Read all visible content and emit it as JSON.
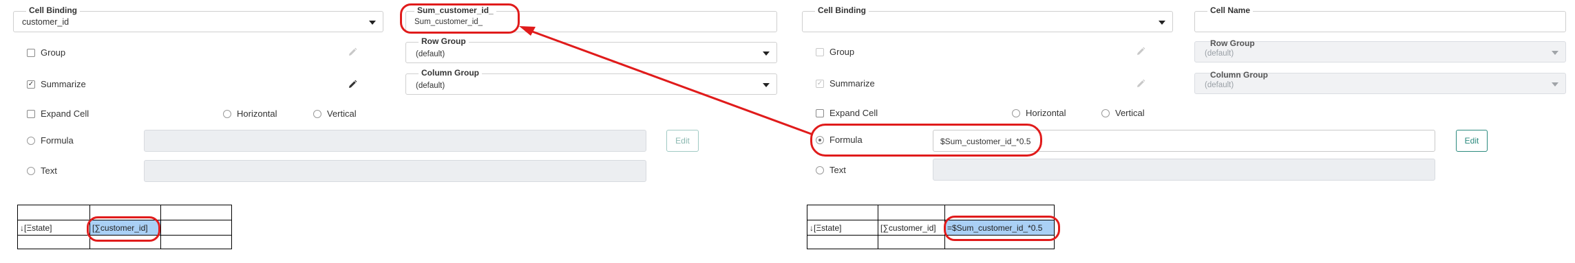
{
  "left_panel": {
    "cell_binding": {
      "legend": "Cell Binding",
      "value": "customer_id"
    },
    "cell_name": {
      "legend": "Sum_customer_id_",
      "value": "Sum_customer_id_"
    },
    "group": {
      "label": "Group",
      "checked": false
    },
    "row_group": {
      "legend": "Row Group",
      "value": "(default)"
    },
    "summarize": {
      "label": "Summarize",
      "checked": true
    },
    "column_group": {
      "legend": "Column Group",
      "value": "(default)"
    },
    "expand_cell": {
      "label": "Expand Cell",
      "checked": false
    },
    "horizontal": {
      "label": "Horizontal"
    },
    "vertical": {
      "label": "Vertical"
    },
    "formula": {
      "label": "Formula",
      "value": ""
    },
    "edit_button": "Edit",
    "text": {
      "label": "Text",
      "value": ""
    },
    "grid": {
      "rows": [
        [
          "",
          "",
          ""
        ],
        [
          "↓[Ξstate]",
          "[∑customer_id]",
          ""
        ],
        [
          "",
          "",
          ""
        ]
      ]
    }
  },
  "right_panel": {
    "cell_binding": {
      "legend": "Cell Binding",
      "value": ""
    },
    "cell_name": {
      "legend": "Cell Name",
      "value": ""
    },
    "group": {
      "label": "Group",
      "checked": false
    },
    "row_group": {
      "legend": "Row Group",
      "value": "(default)"
    },
    "summarize": {
      "label": "Summarize",
      "checked": true
    },
    "column_group": {
      "legend": "Column Group",
      "value": "(default)"
    },
    "expand_cell": {
      "label": "Expand Cell",
      "checked": false
    },
    "horizontal": {
      "label": "Horizontal"
    },
    "vertical": {
      "label": "Vertical"
    },
    "formula": {
      "label": "Formula",
      "value": "$Sum_customer_id_*0.5",
      "selected": true
    },
    "edit_button": "Edit",
    "text": {
      "label": "Text",
      "value": ""
    },
    "grid": {
      "rows": [
        [
          "",
          "",
          ""
        ],
        [
          "↓[Ξstate]",
          "[∑customer_id]",
          "=$Sum_customer_id_*0.5"
        ],
        [
          "",
          "",
          ""
        ]
      ]
    }
  },
  "colors": {
    "annotation_red": "#e01b1b",
    "selected_cell": "#aad0f5",
    "button_teal": "#2b8a7e"
  },
  "icons": [
    "pencil-icon",
    "dropdown-caret-icon",
    "annotation-arrow"
  ]
}
